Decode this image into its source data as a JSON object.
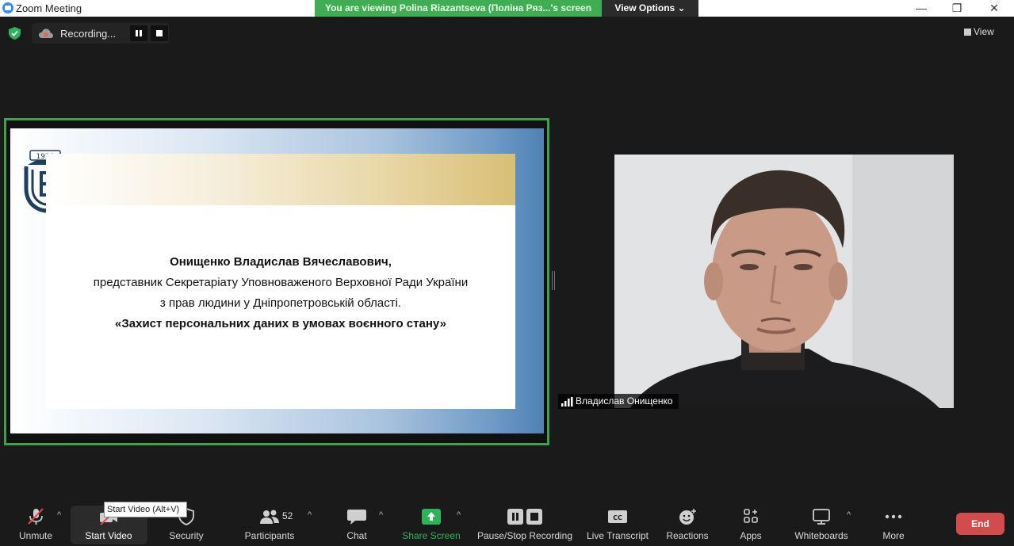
{
  "window": {
    "title": "Zoom Meeting",
    "viewing_banner": "You are viewing Polina Riazantseva (Поліна Ряз...'s screen",
    "view_options": "View Options ⌄",
    "minimize": "—",
    "restore": "❐",
    "close": "✕"
  },
  "meeting": {
    "recording_label": "Recording...",
    "view_label": "View"
  },
  "slide": {
    "logo_year": "1920",
    "line1": "Онищенко Владислав Вячеславович,",
    "line2": "представник Секретаріату Уповноваженого Верховної Ради України",
    "line3": "з прав людини у Дніпропетровській області.",
    "line4": "«Захист персональних даних в умовах воєнного стану»"
  },
  "participant": {
    "name": "Владислав Онищенко"
  },
  "toolbar": {
    "unmute": "Unmute",
    "start_video": "Start Video",
    "start_video_tooltip": "Start Video (Alt+V)",
    "security": "Security",
    "participants": "Participants",
    "participants_count": "52",
    "chat": "Chat",
    "share_screen": "Share Screen",
    "pause_stop_recording": "Pause/Stop Recording",
    "live_transcript": "Live Transcript",
    "reactions": "Reactions",
    "apps": "Apps",
    "whiteboards": "Whiteboards",
    "more": "More",
    "end": "End"
  },
  "colors": {
    "share_border": "#3ea14e",
    "banner": "#3fae52",
    "share_screen_green": "#2fb35a",
    "end_red": "#d44b4b",
    "recording_icon": "#e0665f"
  }
}
